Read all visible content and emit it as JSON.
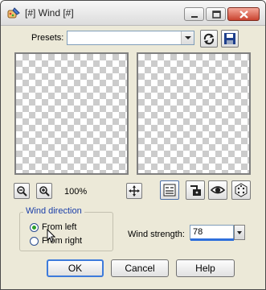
{
  "window": {
    "title": "[#] Wind [#]",
    "controls": [
      "minimize-icon",
      "maximize-icon",
      "close-icon"
    ]
  },
  "presets": {
    "label": "Presets:",
    "value": "",
    "icons": [
      "load-preset-icon",
      "save-preset-icon"
    ]
  },
  "zoom": {
    "level": "100%",
    "icons": [
      "zoom-out-icon",
      "zoom-in-icon",
      "pan-icon"
    ]
  },
  "toolbar_icons": [
    "proof-icon",
    "lock-icon",
    "eye-icon",
    "randomize-icon"
  ],
  "wind_direction": {
    "legend": "Wind direction",
    "options": [
      {
        "label": "From left",
        "checked": true
      },
      {
        "label": "From right",
        "checked": false
      }
    ]
  },
  "wind_strength": {
    "label": "Wind strength:",
    "value": "78"
  },
  "buttons": {
    "ok": "OK",
    "cancel": "Cancel",
    "help": "Help"
  }
}
